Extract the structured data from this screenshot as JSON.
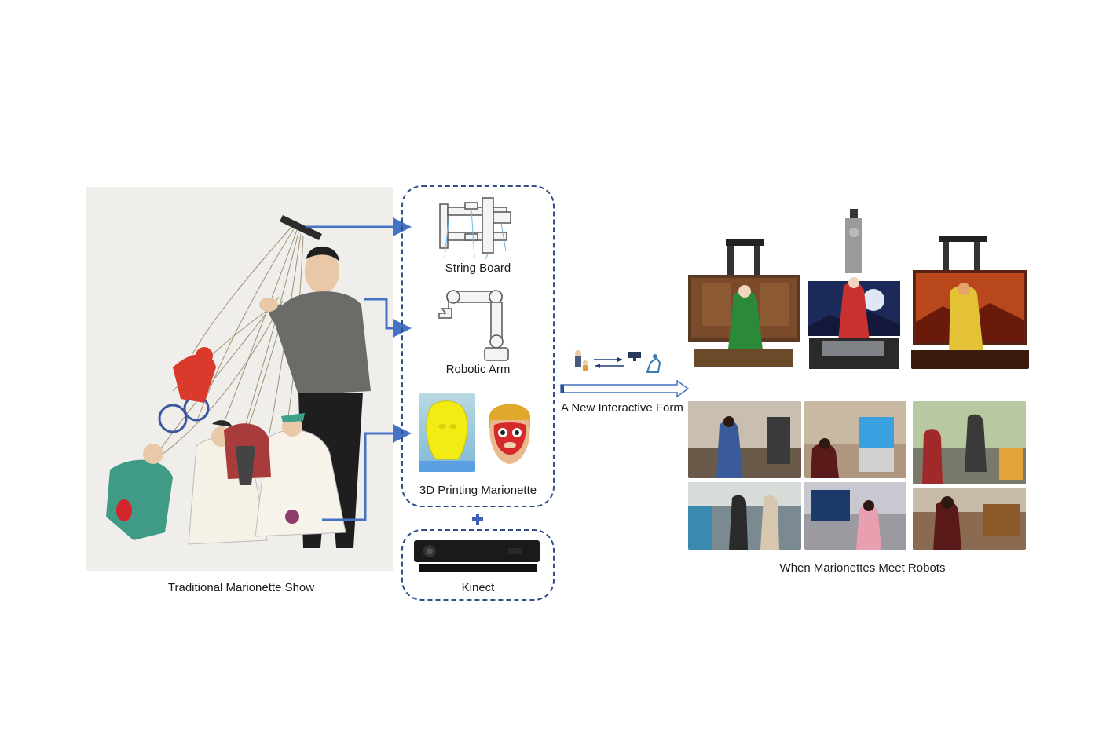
{
  "captions": {
    "traditional": "Traditional Marionette Show",
    "string_board": "String Board",
    "robotic_arm": "Robotic Arm",
    "printing": "3D Printing Marionette",
    "kinect": "Kinect",
    "interactive_form": "A New Interactive  Form",
    "result": "When Marionettes Meet Robots"
  },
  "colors": {
    "arrow_blue": "#4472c4",
    "dashed_border": "#2f4f86",
    "plus": "#3a62b5",
    "painting_bg": "#efeeea"
  }
}
